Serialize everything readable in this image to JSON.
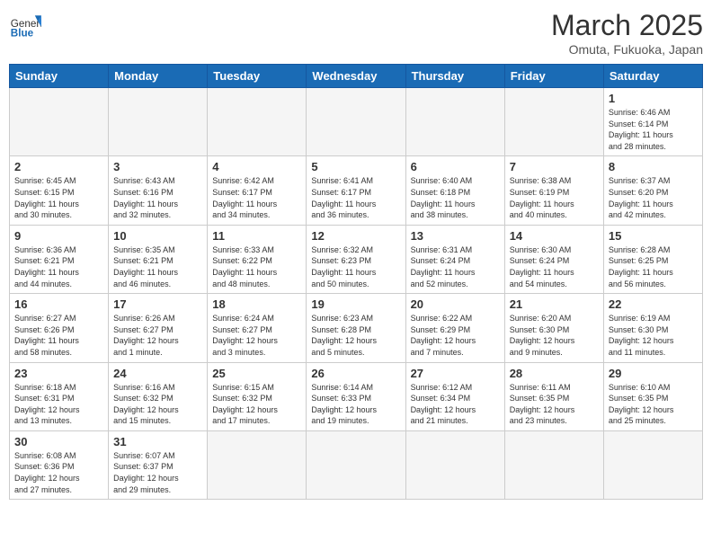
{
  "header": {
    "logo_general": "General",
    "logo_blue": "Blue",
    "month_year": "March 2025",
    "location": "Omuta, Fukuoka, Japan"
  },
  "weekdays": [
    "Sunday",
    "Monday",
    "Tuesday",
    "Wednesday",
    "Thursday",
    "Friday",
    "Saturday"
  ],
  "weeks": [
    [
      {
        "day": "",
        "info": ""
      },
      {
        "day": "",
        "info": ""
      },
      {
        "day": "",
        "info": ""
      },
      {
        "day": "",
        "info": ""
      },
      {
        "day": "",
        "info": ""
      },
      {
        "day": "",
        "info": ""
      },
      {
        "day": "1",
        "info": "Sunrise: 6:46 AM\nSunset: 6:14 PM\nDaylight: 11 hours\nand 28 minutes."
      }
    ],
    [
      {
        "day": "2",
        "info": "Sunrise: 6:45 AM\nSunset: 6:15 PM\nDaylight: 11 hours\nand 30 minutes."
      },
      {
        "day": "3",
        "info": "Sunrise: 6:43 AM\nSunset: 6:16 PM\nDaylight: 11 hours\nand 32 minutes."
      },
      {
        "day": "4",
        "info": "Sunrise: 6:42 AM\nSunset: 6:17 PM\nDaylight: 11 hours\nand 34 minutes."
      },
      {
        "day": "5",
        "info": "Sunrise: 6:41 AM\nSunset: 6:17 PM\nDaylight: 11 hours\nand 36 minutes."
      },
      {
        "day": "6",
        "info": "Sunrise: 6:40 AM\nSunset: 6:18 PM\nDaylight: 11 hours\nand 38 minutes."
      },
      {
        "day": "7",
        "info": "Sunrise: 6:38 AM\nSunset: 6:19 PM\nDaylight: 11 hours\nand 40 minutes."
      },
      {
        "day": "8",
        "info": "Sunrise: 6:37 AM\nSunset: 6:20 PM\nDaylight: 11 hours\nand 42 minutes."
      }
    ],
    [
      {
        "day": "9",
        "info": "Sunrise: 6:36 AM\nSunset: 6:21 PM\nDaylight: 11 hours\nand 44 minutes."
      },
      {
        "day": "10",
        "info": "Sunrise: 6:35 AM\nSunset: 6:21 PM\nDaylight: 11 hours\nand 46 minutes."
      },
      {
        "day": "11",
        "info": "Sunrise: 6:33 AM\nSunset: 6:22 PM\nDaylight: 11 hours\nand 48 minutes."
      },
      {
        "day": "12",
        "info": "Sunrise: 6:32 AM\nSunset: 6:23 PM\nDaylight: 11 hours\nand 50 minutes."
      },
      {
        "day": "13",
        "info": "Sunrise: 6:31 AM\nSunset: 6:24 PM\nDaylight: 11 hours\nand 52 minutes."
      },
      {
        "day": "14",
        "info": "Sunrise: 6:30 AM\nSunset: 6:24 PM\nDaylight: 11 hours\nand 54 minutes."
      },
      {
        "day": "15",
        "info": "Sunrise: 6:28 AM\nSunset: 6:25 PM\nDaylight: 11 hours\nand 56 minutes."
      }
    ],
    [
      {
        "day": "16",
        "info": "Sunrise: 6:27 AM\nSunset: 6:26 PM\nDaylight: 11 hours\nand 58 minutes."
      },
      {
        "day": "17",
        "info": "Sunrise: 6:26 AM\nSunset: 6:27 PM\nDaylight: 12 hours\nand 1 minute."
      },
      {
        "day": "18",
        "info": "Sunrise: 6:24 AM\nSunset: 6:27 PM\nDaylight: 12 hours\nand 3 minutes."
      },
      {
        "day": "19",
        "info": "Sunrise: 6:23 AM\nSunset: 6:28 PM\nDaylight: 12 hours\nand 5 minutes."
      },
      {
        "day": "20",
        "info": "Sunrise: 6:22 AM\nSunset: 6:29 PM\nDaylight: 12 hours\nand 7 minutes."
      },
      {
        "day": "21",
        "info": "Sunrise: 6:20 AM\nSunset: 6:30 PM\nDaylight: 12 hours\nand 9 minutes."
      },
      {
        "day": "22",
        "info": "Sunrise: 6:19 AM\nSunset: 6:30 PM\nDaylight: 12 hours\nand 11 minutes."
      }
    ],
    [
      {
        "day": "23",
        "info": "Sunrise: 6:18 AM\nSunset: 6:31 PM\nDaylight: 12 hours\nand 13 minutes."
      },
      {
        "day": "24",
        "info": "Sunrise: 6:16 AM\nSunset: 6:32 PM\nDaylight: 12 hours\nand 15 minutes."
      },
      {
        "day": "25",
        "info": "Sunrise: 6:15 AM\nSunset: 6:32 PM\nDaylight: 12 hours\nand 17 minutes."
      },
      {
        "day": "26",
        "info": "Sunrise: 6:14 AM\nSunset: 6:33 PM\nDaylight: 12 hours\nand 19 minutes."
      },
      {
        "day": "27",
        "info": "Sunrise: 6:12 AM\nSunset: 6:34 PM\nDaylight: 12 hours\nand 21 minutes."
      },
      {
        "day": "28",
        "info": "Sunrise: 6:11 AM\nSunset: 6:35 PM\nDaylight: 12 hours\nand 23 minutes."
      },
      {
        "day": "29",
        "info": "Sunrise: 6:10 AM\nSunset: 6:35 PM\nDaylight: 12 hours\nand 25 minutes."
      }
    ],
    [
      {
        "day": "30",
        "info": "Sunrise: 6:08 AM\nSunset: 6:36 PM\nDaylight: 12 hours\nand 27 minutes."
      },
      {
        "day": "31",
        "info": "Sunrise: 6:07 AM\nSunset: 6:37 PM\nDaylight: 12 hours\nand 29 minutes."
      },
      {
        "day": "",
        "info": ""
      },
      {
        "day": "",
        "info": ""
      },
      {
        "day": "",
        "info": ""
      },
      {
        "day": "",
        "info": ""
      },
      {
        "day": "",
        "info": ""
      }
    ]
  ]
}
